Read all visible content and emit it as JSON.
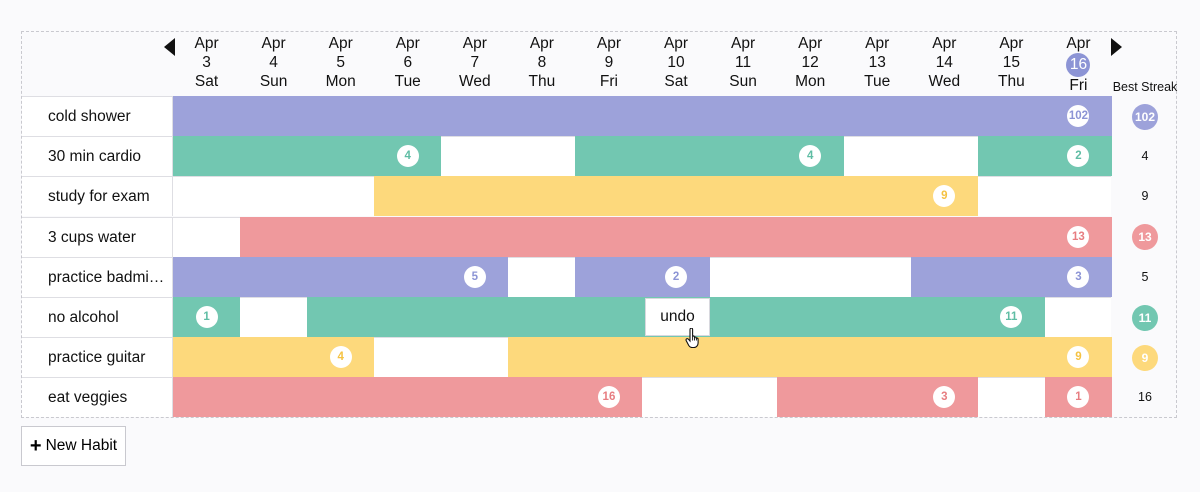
{
  "header": {
    "best_streak_label": "Best Streak",
    "days": [
      {
        "month": "Apr",
        "num": "3",
        "dow": "Sat"
      },
      {
        "month": "Apr",
        "num": "4",
        "dow": "Sun"
      },
      {
        "month": "Apr",
        "num": "5",
        "dow": "Mon"
      },
      {
        "month": "Apr",
        "num": "6",
        "dow": "Tue"
      },
      {
        "month": "Apr",
        "num": "7",
        "dow": "Wed"
      },
      {
        "month": "Apr",
        "num": "8",
        "dow": "Thu"
      },
      {
        "month": "Apr",
        "num": "9",
        "dow": "Fri"
      },
      {
        "month": "Apr",
        "num": "10",
        "dow": "Sat"
      },
      {
        "month": "Apr",
        "num": "11",
        "dow": "Sun"
      },
      {
        "month": "Apr",
        "num": "12",
        "dow": "Mon"
      },
      {
        "month": "Apr",
        "num": "13",
        "dow": "Tue"
      },
      {
        "month": "Apr",
        "num": "14",
        "dow": "Wed"
      },
      {
        "month": "Apr",
        "num": "15",
        "dow": "Thu"
      },
      {
        "month": "Apr",
        "num": "16",
        "dow": "Fri",
        "today": true
      }
    ]
  },
  "colors": {
    "purple": "#9da2da",
    "teal": "#72c7b1",
    "yellow": "#fdd97c",
    "red": "#ef999c",
    "purple_text": "#8c94d5",
    "teal_text": "#5fbda4",
    "yellow_text": "#f5c242",
    "red_text": "#e77d81"
  },
  "habits": [
    {
      "name": "cold shower",
      "color": "purple",
      "best": "102",
      "best_badge": true,
      "segments": [
        {
          "start": 0,
          "end": 13,
          "count": "102"
        }
      ]
    },
    {
      "name": "30 min cardio",
      "color": "teal",
      "best": "4",
      "best_badge": false,
      "segments": [
        {
          "start": 0,
          "end": 3,
          "count": "4"
        },
        {
          "start": 6,
          "end": 9,
          "count": "4"
        },
        {
          "start": 12,
          "end": 13,
          "count": "2"
        }
      ]
    },
    {
      "name": "study for exam",
      "color": "yellow",
      "best": "9",
      "best_badge": false,
      "segments": [
        {
          "start": 3,
          "end": 11,
          "count": "9"
        }
      ]
    },
    {
      "name": "3 cups water",
      "color": "red",
      "best": "13",
      "best_badge": true,
      "segments": [
        {
          "start": 1,
          "end": 13,
          "count": "13"
        }
      ]
    },
    {
      "name": "practice badminton",
      "color": "purple",
      "best": "5",
      "best_badge": false,
      "segments": [
        {
          "start": 0,
          "end": 4,
          "count": "5"
        },
        {
          "start": 6,
          "end": 7,
          "count": "2"
        },
        {
          "start": 11,
          "end": 13,
          "count": "3"
        }
      ]
    },
    {
      "name": "no alcohol",
      "color": "teal",
      "best": "11",
      "best_badge": true,
      "segments": [
        {
          "start": 0,
          "end": 0,
          "count": "1"
        },
        {
          "start": 2,
          "end": 12,
          "count": "11"
        }
      ]
    },
    {
      "name": "practice guitar",
      "color": "yellow",
      "best": "9",
      "best_badge": true,
      "segments": [
        {
          "start": 0,
          "end": 2,
          "count": "4"
        },
        {
          "start": 5,
          "end": 13,
          "count": "9"
        }
      ]
    },
    {
      "name": "eat veggies",
      "color": "red",
      "best": "16",
      "best_badge": false,
      "segments": [
        {
          "start": 0,
          "end": 6,
          "count": "16"
        },
        {
          "start": 9,
          "end": 11,
          "count": "3"
        },
        {
          "start": 13,
          "end": 13,
          "count": "1"
        }
      ]
    }
  ],
  "undo_label": "undo",
  "new_habit_label": "New Habit"
}
